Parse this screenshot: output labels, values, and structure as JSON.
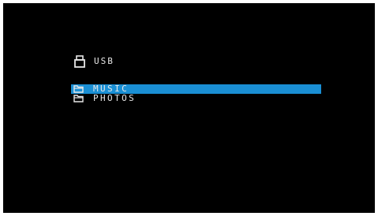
{
  "header": {
    "icon": "usb-drive-icon",
    "label": "USB"
  },
  "list": {
    "items": [
      {
        "label": "MUSIC",
        "icon": "folder-icon",
        "selected": true
      },
      {
        "label": "PHOTOS",
        "icon": "folder-icon",
        "selected": false
      }
    ]
  },
  "colors": {
    "background": "#000000",
    "text": "#e8e8e8",
    "highlight": "#1a8fd4"
  }
}
